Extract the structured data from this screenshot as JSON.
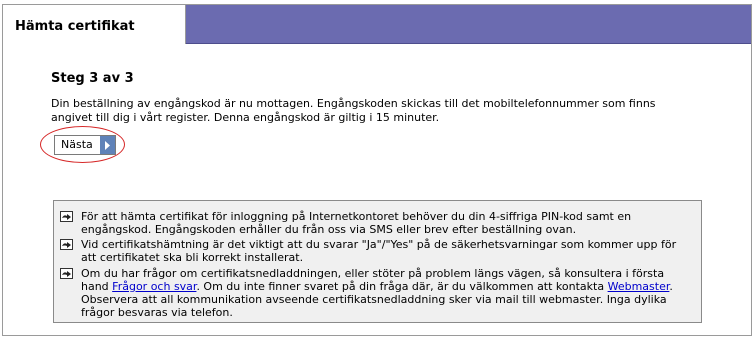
{
  "tab": {
    "title": "Hämta certifikat"
  },
  "step": {
    "title": "Steg 3 av 3",
    "description": "Din beställning av engångskod är nu mottagen. Engångskoden skickas till det mobiltelefonnummer som finns angivet till dig i vårt register. Denna engångskod är giltig i 15 minuter."
  },
  "next_button": {
    "label": "Nästa",
    "icon": "chevron-right-icon"
  },
  "info": {
    "item1": "För att hämta certifikat för inloggning på Internetkontoret behöver du din 4-siffriga PIN-kod samt en engångskod. Engångskoden erhåller du från oss via SMS eller brev efter beställning ovan.",
    "item2": "Vid certifikatshämtning är det viktigt att du svarar \"Ja\"/\"Yes\" på de säkerhetsvarningar som kommer upp för att certifikatet ska bli korrekt installerat.",
    "item3_part1": "Om du har frågor om certifikatsnedladdningen, eller stöter på problem längs vägen, så konsultera i första hand ",
    "item3_link1": "Frågor och svar",
    "item3_part2": ". Om du inte finner svaret på din fråga där, är du välkommen att kontakta ",
    "item3_link2": "Webmaster",
    "item3_part3": ". Observera att all kommunikation avseende certifikatsnedladdning sker via mail till webmaster. Inga dylika frågor besvaras via telefon."
  },
  "colors": {
    "header": "#6b6bb0",
    "button_arrow": "#5f82b8",
    "highlight": "#d62828"
  }
}
